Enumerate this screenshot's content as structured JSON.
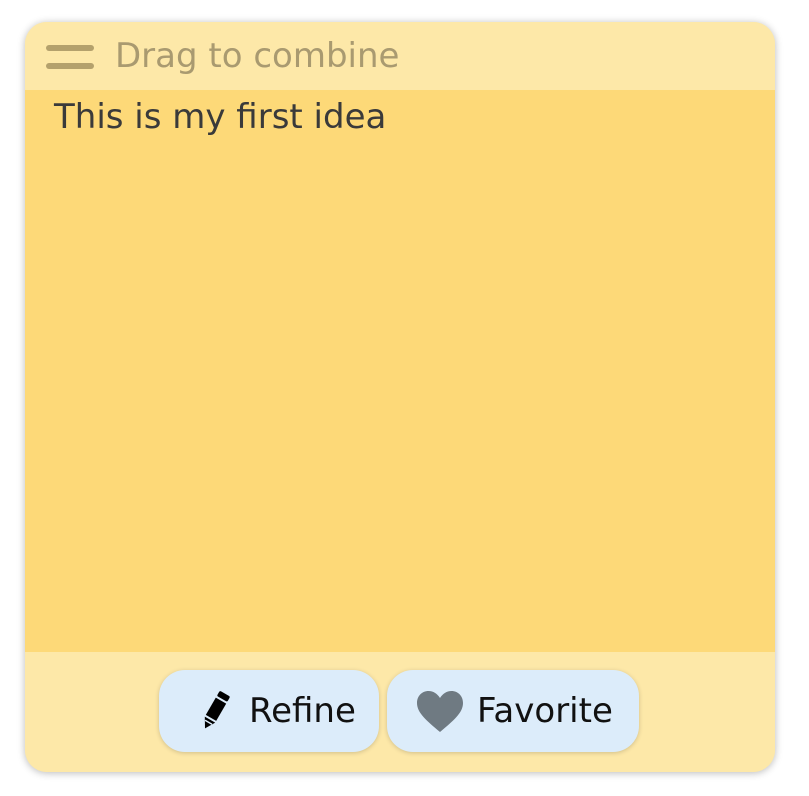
{
  "card": {
    "header": {
      "drag_label": "Drag to combine",
      "handle_icon": "drag-handle-icon"
    },
    "idea_text": "This is my first idea",
    "actions": {
      "refine": {
        "label": "Refine",
        "icon": "pencil-icon"
      },
      "favorite": {
        "label": "Favorite",
        "icon": "heart-icon"
      }
    }
  },
  "colors": {
    "card_light": "#fde8a8",
    "card_body": "#fdd978",
    "button_bg": "#dcecfa",
    "heart": "#6f7a82"
  }
}
